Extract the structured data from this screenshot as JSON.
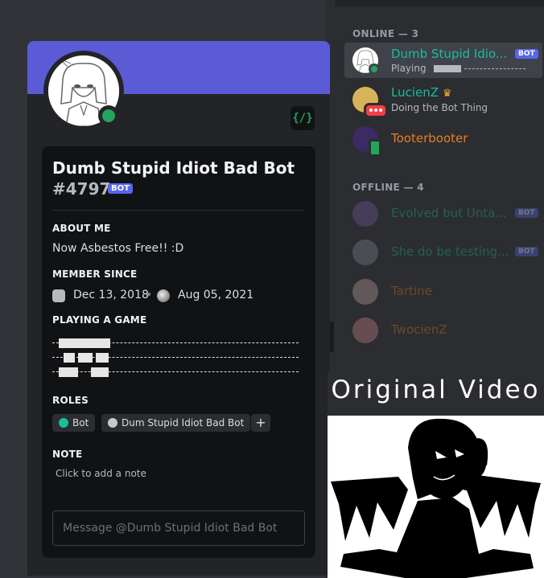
{
  "profile": {
    "username": "Dumb Stupid Idiot Bad Bot",
    "discriminator": "#4797",
    "bot_tag": "BOT",
    "dev_badge_icon": "developer-badge-icon",
    "banner_color": "#5b5bd6",
    "about_title": "ABOUT ME",
    "about_text": "Now Asbestos Free!! :D",
    "member_since_title": "MEMBER SINCE",
    "discord_since": "Dec 13, 2018",
    "separator": "•",
    "server_since": "Aug 05, 2021",
    "playing_title": "PLAYING A GAME",
    "roles_title": "ROLES",
    "roles": [
      {
        "name": "Bot",
        "color": "#1abc9c"
      },
      {
        "name": "Dum Stupid Idiot Bad Bot",
        "color": "#c4c9ce"
      }
    ],
    "add_role": "+",
    "note_title": "NOTE",
    "note_placeholder": "Click to add a note",
    "message_placeholder": "Message @Dumb Stupid Idiot Bad Bot"
  },
  "members": {
    "online_title": "ONLINE — 3",
    "offline_title": "OFFLINE — 4",
    "online": [
      {
        "name": "Dumb Stupid Idio...",
        "sub": "Playing",
        "tag": "BOT",
        "color": "#1abc9c",
        "status": "online"
      },
      {
        "name": "LucienZ",
        "sub": "Doing the Bot Thing",
        "color": "#1abc9c",
        "status": "dnd",
        "crown": "♛"
      },
      {
        "name": "Tooterbooter",
        "color": "#e67e22",
        "status": "mobile"
      }
    ],
    "offline": [
      {
        "name": "Evolved but Unta...",
        "tag": "BOT",
        "color": "#1abc9c"
      },
      {
        "name": "She do be testing...",
        "tag": "BOT",
        "color": "#1abc9c"
      },
      {
        "name": "Tartine",
        "color": "#e67e22"
      },
      {
        "name": "TwocienZ",
        "color": "#e67e22"
      }
    ]
  },
  "overlay": {
    "label": "Original Video"
  }
}
